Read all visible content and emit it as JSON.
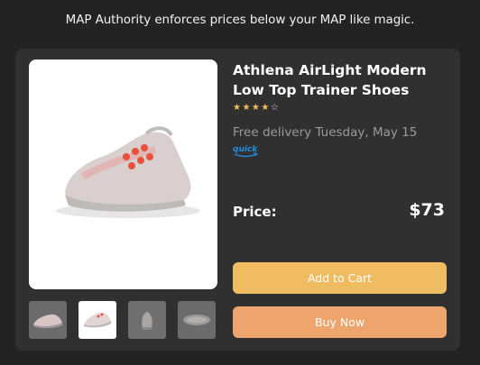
{
  "banner": {
    "text": "MAP Authority enforces prices below your MAP like magic."
  },
  "product": {
    "title": "Athlena AirLight Modern Low Top Trainer Shoes",
    "rating": {
      "value": 4,
      "max": 5,
      "filled_glyph": "★★★★",
      "empty_glyph": "☆"
    },
    "delivery": "Free delivery Tuesday, May 15",
    "delivery_badge": "quick",
    "price_label": "Price:",
    "price_value": "$73"
  },
  "gallery": {
    "main_image": "shoe-side-view",
    "thumbnails": [
      "shoe-side-view",
      "shoe-angle-view",
      "shoe-back-view",
      "shoe-sole-view"
    ],
    "selected_index": 1
  },
  "actions": {
    "add_to_cart": "Add to Cart",
    "buy_now": "Buy Now"
  },
  "colors": {
    "page_bg": "#232323",
    "card_bg": "#303030",
    "add_to_cart": "#efbc61",
    "buy_now": "#eea56d",
    "star": "#f3c05a",
    "quick_badge": "#1f8fe0"
  }
}
